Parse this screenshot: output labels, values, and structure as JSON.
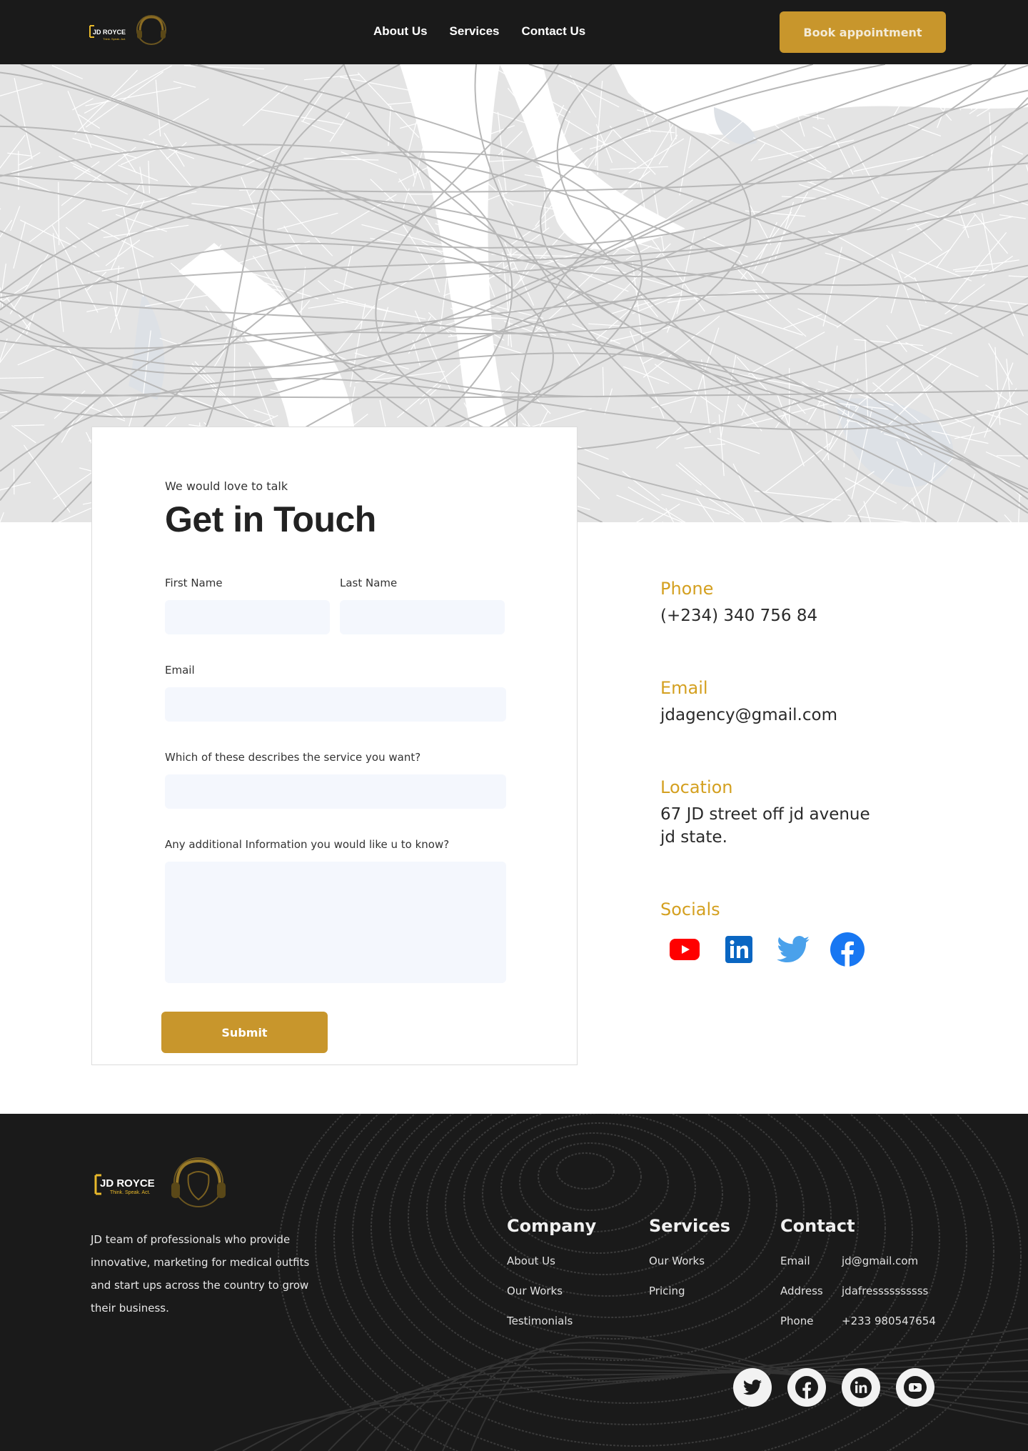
{
  "nav": {
    "logo_text": "JD ROYCE",
    "logo_tagline": "Think. Speak. Act.",
    "links": [
      "About Us",
      "Services",
      "Contact Us"
    ],
    "cta": "Book appointment"
  },
  "form": {
    "eyebrow": "We would love to talk",
    "title": "Get in Touch",
    "first_name_label": "First Name",
    "last_name_label": "Last Name",
    "email_label": "Email",
    "service_label": "Which of these describes the service you want?",
    "info_label": "Any additional Information you would like u to know?",
    "first_name_value": "",
    "last_name_value": "",
    "email_value": "",
    "service_value": "",
    "info_value": "",
    "submit": "Submit"
  },
  "contact_info": {
    "phone_heading": "Phone",
    "phone": "(+234) 340 756 84",
    "email_heading": "Email",
    "email": "jdagency@gmail.com",
    "location_heading": "Location",
    "location_line1": "67 JD street off jd avenue",
    "location_line2": "jd state.",
    "socials_heading": "Socials",
    "socials": [
      "youtube-icon",
      "linkedin-icon",
      "twitter-icon",
      "facebook-icon"
    ]
  },
  "footer": {
    "logo_text": "JD ROYCE",
    "logo_tagline": "Think. Speak. Act.",
    "description": "JD team of professionals who provide innovative, marketing for medical outfits and start ups across the country to grow their business.",
    "company": {
      "heading": "Company",
      "links": [
        "About Us",
        "Our Works",
        "Testimonials"
      ]
    },
    "services": {
      "heading": "Services",
      "links": [
        "Our Works",
        "Pricing"
      ]
    },
    "contact": {
      "heading": "Contact",
      "rows": [
        {
          "key": "Email",
          "value": "jd@gmail.com"
        },
        {
          "key": "Address",
          "value": "jdafressssssssss"
        },
        {
          "key": "Phone",
          "value": "+233 980547654"
        }
      ]
    },
    "socials": [
      "twitter-icon",
      "facebook-icon",
      "linkedin-icon",
      "youtube-icon"
    ]
  },
  "colors": {
    "accent": "#c8962c",
    "heading_accent": "#d4a020",
    "dark": "#1a1a1a",
    "input_bg": "#f4f7fd"
  }
}
